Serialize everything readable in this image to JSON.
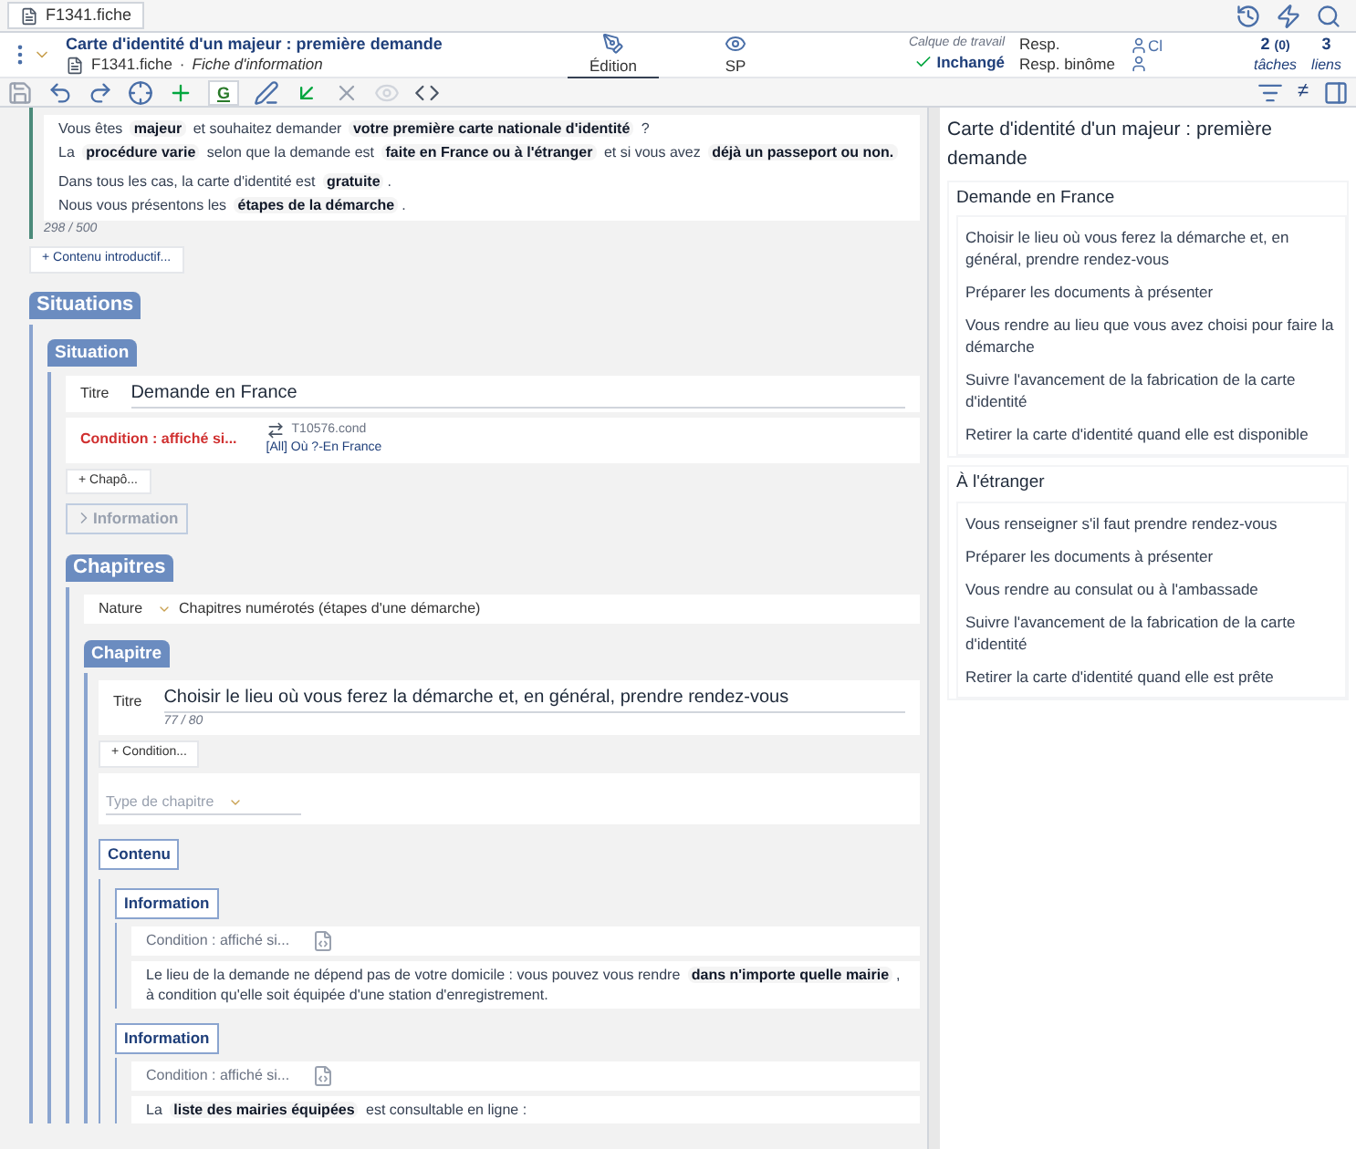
{
  "tab": {
    "label": "F1341.fiche"
  },
  "header": {
    "title": "Carte d'identité d'un majeur : première demande",
    "file": "F1341.fiche",
    "separator": "·",
    "doc_type": "Fiche d'information",
    "modes": [
      {
        "label": "Édition",
        "selected": true,
        "kind": "pen"
      },
      {
        "label": "SP",
        "selected": false,
        "kind": "eye"
      }
    ],
    "layer_label": "Calque de travail",
    "layer_status": "Inchangé",
    "resp_labels": [
      "Resp.",
      "Resp. binôme"
    ],
    "resp_name": "Cl",
    "tasks": {
      "count": "2",
      "sub": "(0)",
      "label": "tâches"
    },
    "links": {
      "count": "3",
      "label": "liens"
    }
  },
  "toolbar": {
    "g_label": "G",
    "neq_label": "≠"
  },
  "intro": {
    "paragraphs": [
      [
        {
          "text": "Vous êtes ",
          "kind": "plain"
        },
        {
          "text": "majeur",
          "kind": "tagged"
        },
        {
          "text": " et souhaitez demander ",
          "kind": "plain"
        },
        {
          "text": "votre première carte nationale d'identité",
          "kind": "tagged"
        },
        {
          "text": " ?",
          "kind": "plain"
        }
      ],
      [
        {
          "text": "La ",
          "kind": "plain"
        },
        {
          "text": "procédure varie",
          "kind": "tagged"
        },
        {
          "text": " selon que la demande est ",
          "kind": "plain"
        },
        {
          "text": "faite en France ou à l'étranger",
          "kind": "tagged"
        },
        {
          "text": " et si vous avez ",
          "kind": "plain"
        },
        {
          "text": "déjà un passeport ou non.",
          "kind": "tagged"
        }
      ],
      [
        {
          "text": "Dans tous les cas, la carte d'identité est ",
          "kind": "plain"
        },
        {
          "text": "gratuite",
          "kind": "tagged"
        },
        {
          "text": ".",
          "kind": "plain"
        }
      ],
      [
        {
          "text": "Nous vous présentons les ",
          "kind": "plain"
        },
        {
          "text": "étapes de la démarche",
          "kind": "tagged"
        },
        {
          "text": ".",
          "kind": "plain"
        }
      ]
    ],
    "counter": "298 / 500",
    "add_button": "+ Contenu introductif..."
  },
  "situations": {
    "label": "Situations",
    "situation_label": "Situation",
    "title_label": "Titre",
    "title_value": "Demande en France",
    "condition_label": "Condition : affiché si...",
    "condition_file": "T10576.cond",
    "condition_value": "[All] Où ?-En France",
    "add_chapo": "+ Chapô...",
    "information_label": "Information",
    "chapters": {
      "label": "Chapitres",
      "nature_label": "Nature",
      "nature_value": "Chapitres numérotés (étapes d'une démarche)",
      "chapter": {
        "label": "Chapitre",
        "title_label": "Titre",
        "title_value": "Choisir le lieu où vous ferez la démarche et, en général, prendre rendez-vous",
        "counter": "77 / 80",
        "add_condition": "+ Condition...",
        "type_placeholder": "Type de chapitre",
        "content_label": "Contenu",
        "blocks": [
          {
            "label": "Information",
            "condition": "Condition : affiché si...",
            "segments": [
              {
                "text": "Le lieu de la demande ne dépend pas de votre domicile : vous pouvez vous rendre ",
                "kind": "plain"
              },
              {
                "text": "dans n'importe quelle mairie",
                "kind": "tagged"
              },
              {
                "text": ", à condition qu'elle soit équipée d'une station d'enregistrement.",
                "kind": "plain"
              }
            ]
          },
          {
            "label": "Information",
            "condition": "Condition : affiché si...",
            "segments": [
              {
                "text": "La ",
                "kind": "plain"
              },
              {
                "text": "liste des mairies équipées",
                "kind": "tagged"
              },
              {
                "text": " est consultable en ligne :",
                "kind": "plain"
              }
            ]
          }
        ]
      }
    }
  },
  "outline": {
    "title": "Carte d'identité d'un majeur : première demande",
    "sections": [
      {
        "title": "Demande en France",
        "items": [
          "Choisir le lieu où vous ferez la démarche et, en général, prendre rendez-vous",
          "Préparer les documents à présenter",
          "Vous rendre au lieu que vous avez choisi pour faire la démarche",
          "Suivre l'avancement de la fabrication de la carte d'identité",
          "Retirer la carte d'identité quand elle est disponible"
        ]
      },
      {
        "title": "À l'étranger",
        "items": [
          "Vous renseigner s'il faut prendre rendez-vous",
          "Préparer les documents à présenter",
          "Vous rendre au consulat ou à l'ambassade",
          "Suivre l'avancement de la fabrication de la carte d'identité",
          "Retirer la carte d'identité quand elle est prête"
        ]
      }
    ]
  }
}
